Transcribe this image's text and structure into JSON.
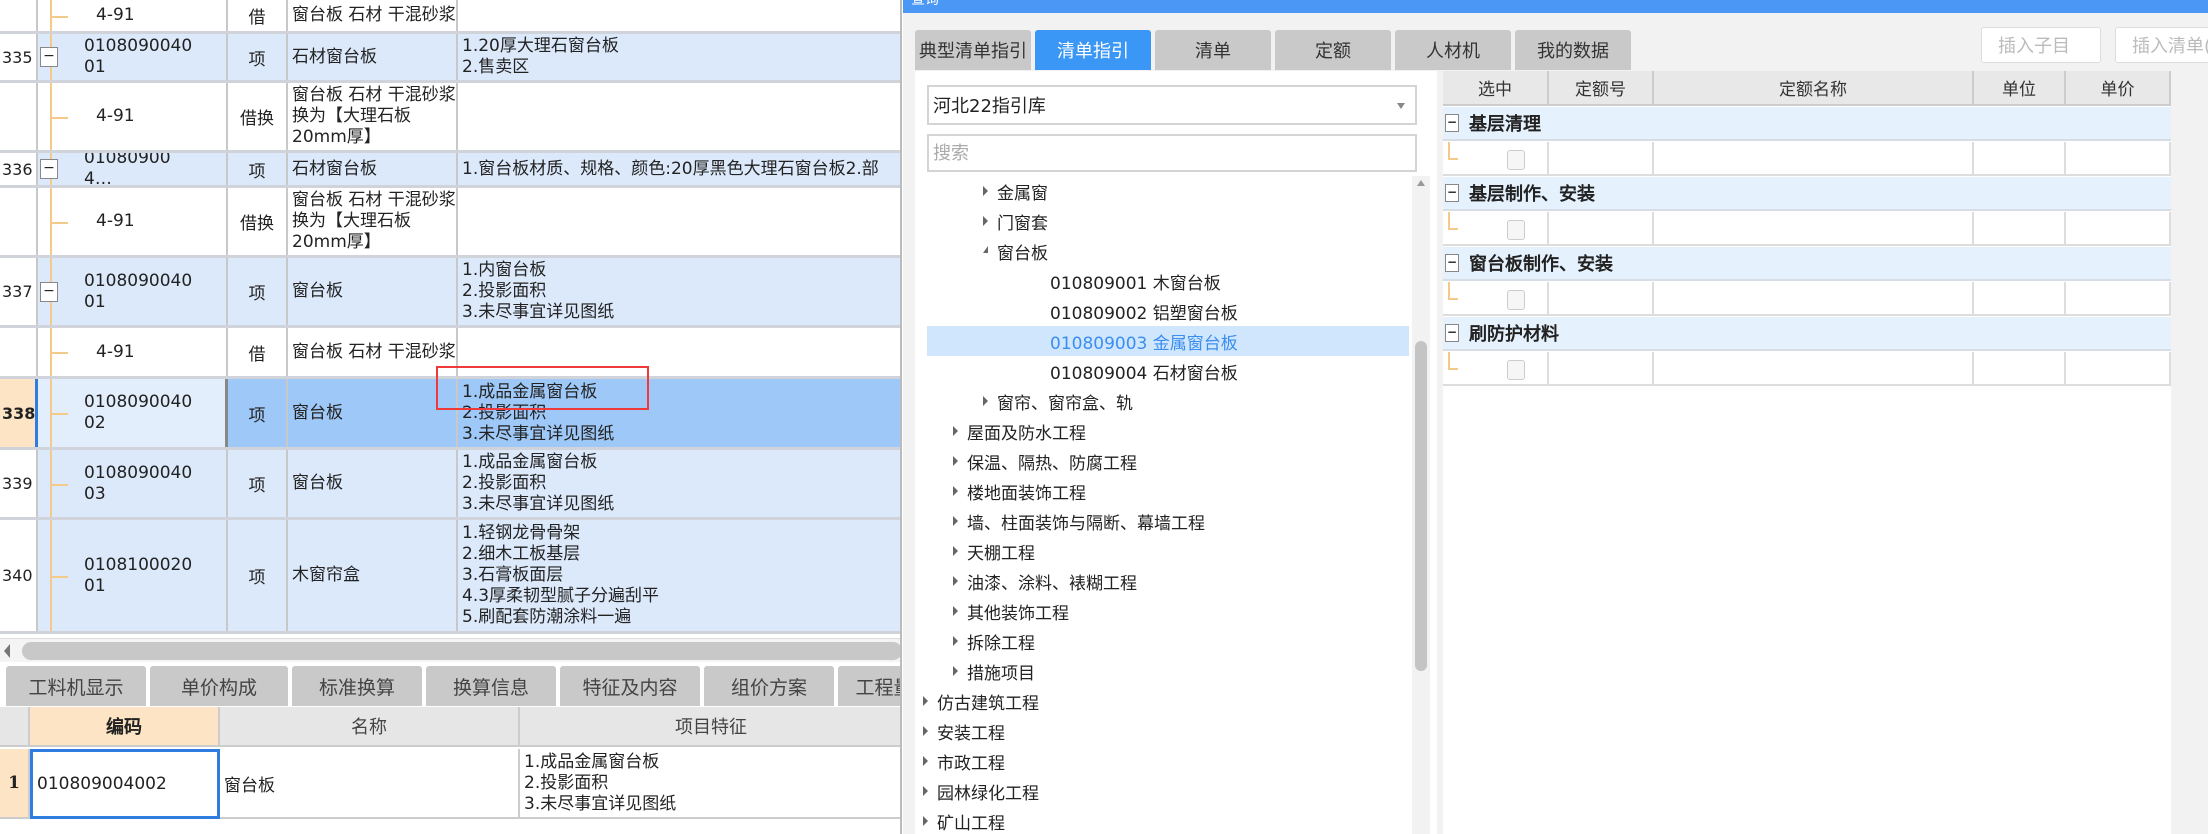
{
  "left_table": {
    "rows": [
      {
        "num": "",
        "code": "4-91",
        "type": "借",
        "name": "窗台板 石材 干混砂浆",
        "desc": "",
        "kind": "child"
      },
      {
        "num": "335",
        "code": "010809004001",
        "type": "项",
        "name": "石材窗台板",
        "desc": "1.20厚大理石窗台板\n2.售卖区",
        "kind": "item"
      },
      {
        "num": "",
        "code": "4-91",
        "type": "借换",
        "name": "窗台板 石材 干混砂浆  换为【大理石板20mm厚】",
        "desc": "",
        "kind": "child"
      },
      {
        "num": "336",
        "code": "010809004…",
        "type": "项",
        "name": "石材窗台板",
        "desc": "1.窗台板材质、规格、颜色:20厚黑色大理石窗台板2.部",
        "kind": "item"
      },
      {
        "num": "",
        "code": "4-91",
        "type": "借换",
        "name": "窗台板 石材 干混砂浆  换为【大理石板20mm厚】",
        "desc": "",
        "kind": "child"
      },
      {
        "num": "337",
        "code": "010809004001",
        "type": "项",
        "name": "窗台板",
        "desc": "1.内窗台板\n2.投影面积\n3.未尽事宜详见图纸",
        "kind": "item"
      },
      {
        "num": "",
        "code": "4-91",
        "type": "借",
        "name": "窗台板 石材 干混砂浆",
        "desc": "",
        "kind": "child"
      },
      {
        "num": "338",
        "code": "010809004002",
        "type": "项",
        "name": "窗台板",
        "desc": "1.成品金属窗台板\n2.投影面积\n3.未尽事宜详见图纸",
        "kind": "selected"
      },
      {
        "num": "339",
        "code": "010809004003",
        "type": "项",
        "name": "窗台板",
        "desc": "1.成品金属窗台板\n2.投影面积\n3.未尽事宜详见图纸",
        "kind": "item"
      },
      {
        "num": "340",
        "code": "010810002001",
        "type": "项",
        "name": "木窗帘盒",
        "desc": "1.轻钢龙骨骨架\n2.细木工板基层\n3.石膏板面层\n4.3厚柔韧型腻子分遍刮平\n5.刷配套防潮涂料一遍",
        "kind": "item"
      }
    ]
  },
  "bottom_tabs": [
    "工料机显示",
    "单价构成",
    "标准换算",
    "换算信息",
    "特征及内容",
    "组价方案",
    "工程量明细"
  ],
  "bottom_grid": {
    "headers": [
      "编码",
      "名称",
      "项目特征"
    ],
    "row": {
      "num": "1",
      "code": "010809004002",
      "name": "窗台板",
      "desc": "1.成品金属窗台板\n2.投影面积\n3.未尽事宜详见图纸"
    }
  },
  "dialog": {
    "title": "查询",
    "tabs": [
      "典型清单指引",
      "清单指引",
      "清单",
      "定额",
      "人材机",
      "我的数据"
    ],
    "active_tab": 1,
    "insert_child_button": "插入子目",
    "insert_list_button": "插入清单(",
    "library_select": "河北22指引库",
    "search_placeholder": "搜索",
    "tree": [
      {
        "label": "金属窗",
        "level": 2,
        "state": "collapsed"
      },
      {
        "label": "门窗套",
        "level": 2,
        "state": "collapsed"
      },
      {
        "label": "窗台板",
        "level": 2,
        "state": "expanded"
      },
      {
        "label": "010809001  木窗台板",
        "level": 3,
        "state": "leaf"
      },
      {
        "label": "010809002  铝塑窗台板",
        "level": 3,
        "state": "leaf"
      },
      {
        "label": "010809003  金属窗台板",
        "level": 3,
        "state": "leaf",
        "selected": true
      },
      {
        "label": "010809004  石材窗台板",
        "level": 3,
        "state": "leaf"
      },
      {
        "label": "窗帘、窗帘盒、轨",
        "level": 2,
        "state": "collapsed"
      },
      {
        "label": "屋面及防水工程",
        "level": 1,
        "state": "collapsed"
      },
      {
        "label": "保温、隔热、防腐工程",
        "level": 1,
        "state": "collapsed"
      },
      {
        "label": "楼地面装饰工程",
        "level": 1,
        "state": "collapsed"
      },
      {
        "label": "墙、柱面装饰与隔断、幕墙工程",
        "level": 1,
        "state": "collapsed"
      },
      {
        "label": "天棚工程",
        "level": 1,
        "state": "collapsed"
      },
      {
        "label": "油漆、涂料、裱糊工程",
        "level": 1,
        "state": "collapsed"
      },
      {
        "label": "其他装饰工程",
        "level": 1,
        "state": "collapsed"
      },
      {
        "label": "拆除工程",
        "level": 1,
        "state": "collapsed"
      },
      {
        "label": "措施项目",
        "level": 1,
        "state": "collapsed"
      },
      {
        "label": "仿古建筑工程",
        "level": 0,
        "state": "collapsed"
      },
      {
        "label": "安装工程",
        "level": 0,
        "state": "collapsed"
      },
      {
        "label": "市政工程",
        "level": 0,
        "state": "collapsed"
      },
      {
        "label": "园林绿化工程",
        "level": 0,
        "state": "collapsed"
      },
      {
        "label": "矿山工程",
        "level": 0,
        "state": "collapsed"
      }
    ],
    "grid_headers": [
      "选中",
      "定额号",
      "定额名称",
      "单位",
      "单价"
    ],
    "groups": [
      "基层清理",
      "基层制作、安装",
      "窗台板制作、安装",
      "刷防护材料"
    ]
  },
  "colors": {
    "accent": "#3b97f5",
    "selected_row": "#9ec8f7",
    "item_row": "#dce9fb",
    "annotation": "#f03a3a"
  }
}
